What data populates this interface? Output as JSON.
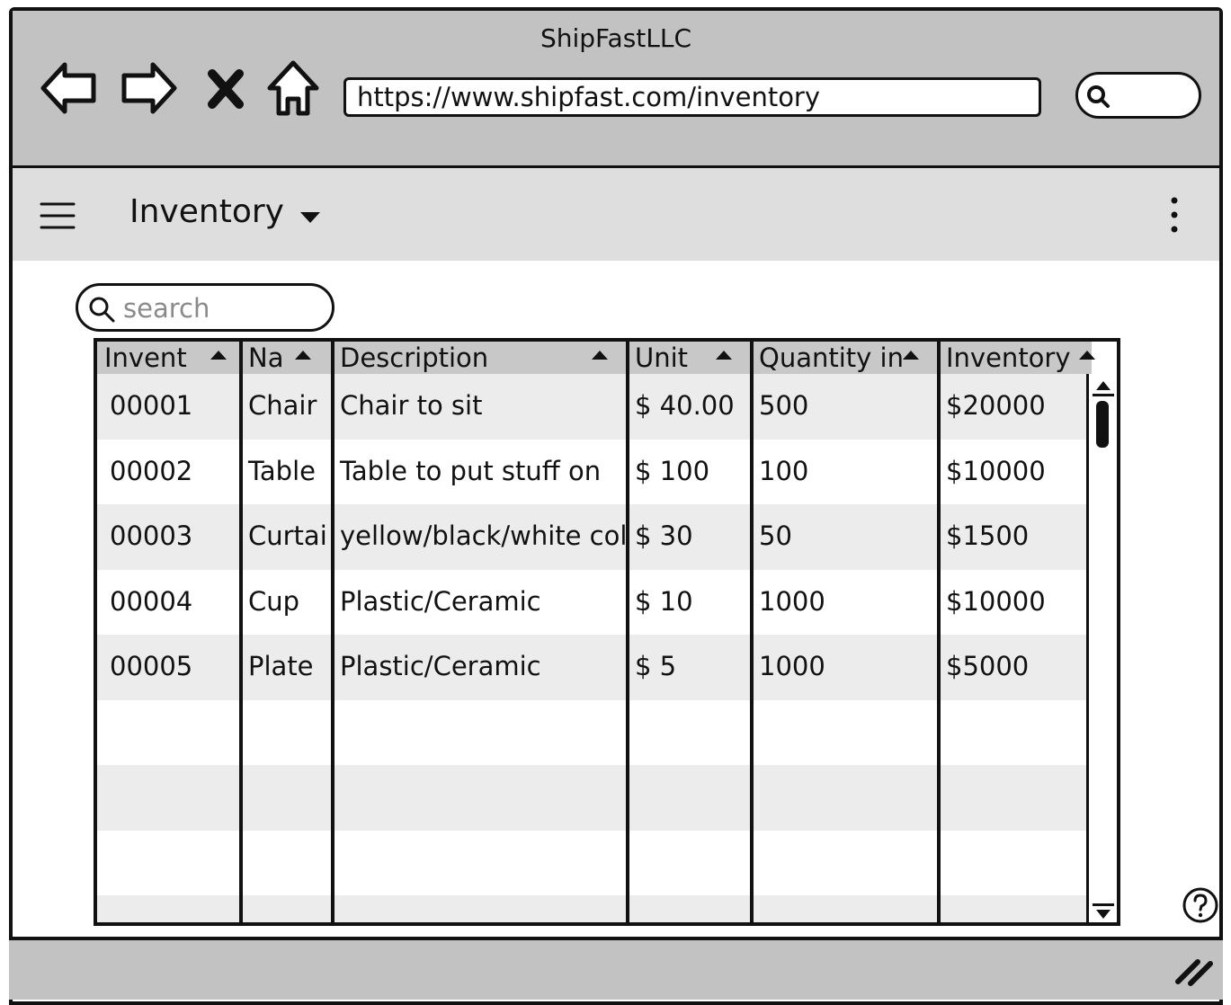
{
  "browser": {
    "window_title": "ShipFastLLC",
    "url": "https://www.shipfast.com/inventory"
  },
  "appbar": {
    "title": "Inventory"
  },
  "search": {
    "placeholder": "search"
  },
  "table": {
    "columns": [
      {
        "label": "Invent"
      },
      {
        "label": "Na"
      },
      {
        "label": "Description"
      },
      {
        "label": "Unit"
      },
      {
        "label": "Quantity in"
      },
      {
        "label": "Inventory"
      }
    ],
    "rows": [
      {
        "id": "00001",
        "name": "Chair",
        "description": "Chair to sit",
        "unit": "$ 40.00",
        "quantity": "500",
        "inventory": "$20000"
      },
      {
        "id": "00002",
        "name": "Table",
        "description": "Table to put stuff on",
        "unit": "$ 100",
        "quantity": "100",
        "inventory": "$10000"
      },
      {
        "id": "00003",
        "name": "Curtai",
        "description": "yellow/black/white col",
        "unit": "$ 30",
        "quantity": "50",
        "inventory": "$1500"
      },
      {
        "id": "00004",
        "name": "Cup",
        "description": "Plastic/Ceramic",
        "unit": "$ 10",
        "quantity": "1000",
        "inventory": "$10000"
      },
      {
        "id": "00005",
        "name": "Plate",
        "description": "Plastic/Ceramic",
        "unit": "$ 5",
        "quantity": "1000",
        "inventory": "$5000"
      }
    ]
  },
  "colors": {
    "chrome": "#c2c2c2",
    "appbar": "#dedede",
    "row_alt": "#ececec",
    "header": "#c8c8c8"
  }
}
